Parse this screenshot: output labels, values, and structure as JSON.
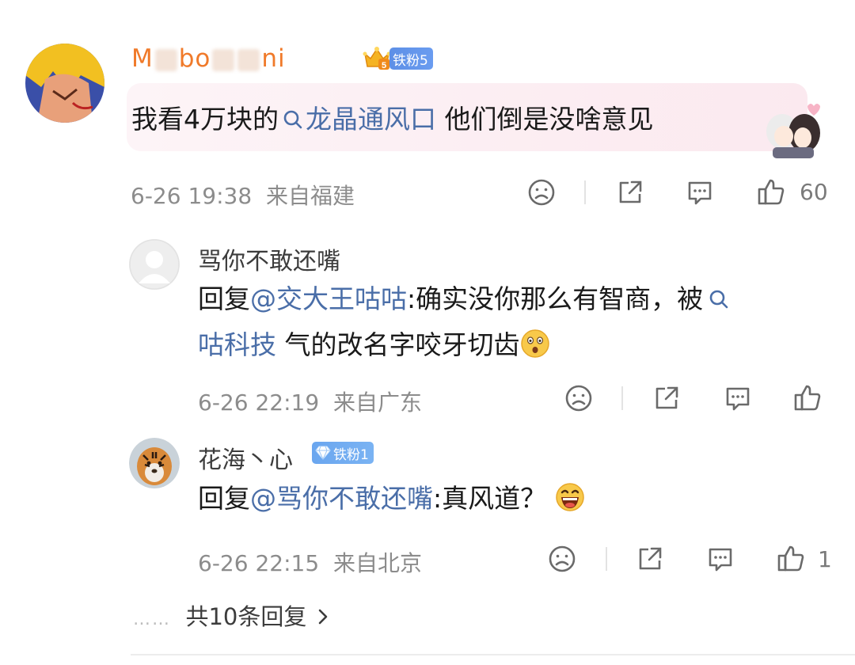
{
  "main_comment": {
    "username_prefix": "M",
    "username_mid1": "bo",
    "username_suffix": "ni",
    "fan_badge": "铁粉5",
    "crown_level": "5",
    "text_before": "我看4万块的",
    "topic": "龙晶通风口",
    "text_after": " 他们倒是没啥意见",
    "time": "6-26 19:38",
    "location": "来自福建",
    "like_count": "60"
  },
  "replies": [
    {
      "username": "骂你不敢还嘴",
      "reply_label": "回复",
      "mention": "@交大王咕咕",
      "text_line1": ":确实没你那么有智商，被",
      "topic": "咕科技",
      "text_line2": " 气的改名字咬牙切齿",
      "time": "6-26 22:19",
      "location": "来自广东",
      "like_count": ""
    },
    {
      "username": "花海丶心",
      "fan_badge": "铁粉1",
      "reply_label": "回复",
      "mention": "@骂你不敢还嘴",
      "text": ":真风道？",
      "time": "6-26 22:15",
      "location": "来自北京",
      "like_count": "1"
    }
  ],
  "more_replies": {
    "dots": "……",
    "label": "共10条回复"
  },
  "colors": {
    "link": "#4a6ea8",
    "username_orange": "#f07a2a",
    "meta_gray": "#8c8c8c",
    "badge_blue": "#5d8fe6"
  },
  "icons": [
    "sad-face-icon",
    "share-icon",
    "comment-icon",
    "like-icon",
    "search-icon",
    "chevron-right-icon",
    "crown-icon",
    "diamond-icon"
  ]
}
